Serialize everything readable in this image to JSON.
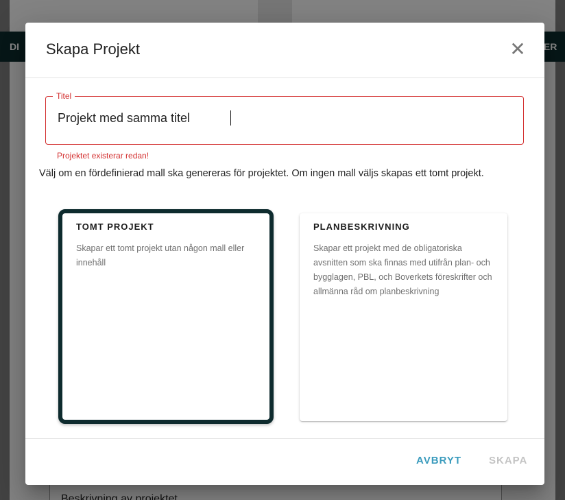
{
  "background": {
    "header_left_text": "DI",
    "header_right_text": "GER",
    "field_text": "Beskrivning av projektet"
  },
  "dialog": {
    "title": "Skapa Projekt",
    "close_glyph": "✕",
    "title_field": {
      "label": "Titel",
      "value": "Projekt med samma titel",
      "error": "Projektet existerar redan!"
    },
    "description": "Välj om en fördefinierad mall ska genereras för projektet. Om ingen mall väljs skapas ett tomt projekt.",
    "templates": [
      {
        "title": "TOMT PROJEKT",
        "description": "Skapar ett tomt projekt utan någon mall eller innehåll",
        "selected": true
      },
      {
        "title": "PLANBESKRIVNING",
        "description": "Skapar ett projekt med de obligatoriska avsnitten som ska finnas med utifrån plan- och bygglagen, PBL, och Boverkets föreskrifter och allmänna råd om planbeskrivning",
        "selected": false
      }
    ],
    "buttons": {
      "cancel": "AVBRYT",
      "create": "SKAPA"
    }
  },
  "colors": {
    "brand_dark": "#0e2b2e",
    "error": "#d32f2f",
    "action": "#3a9bbd",
    "disabled": "#c4c4c4"
  }
}
